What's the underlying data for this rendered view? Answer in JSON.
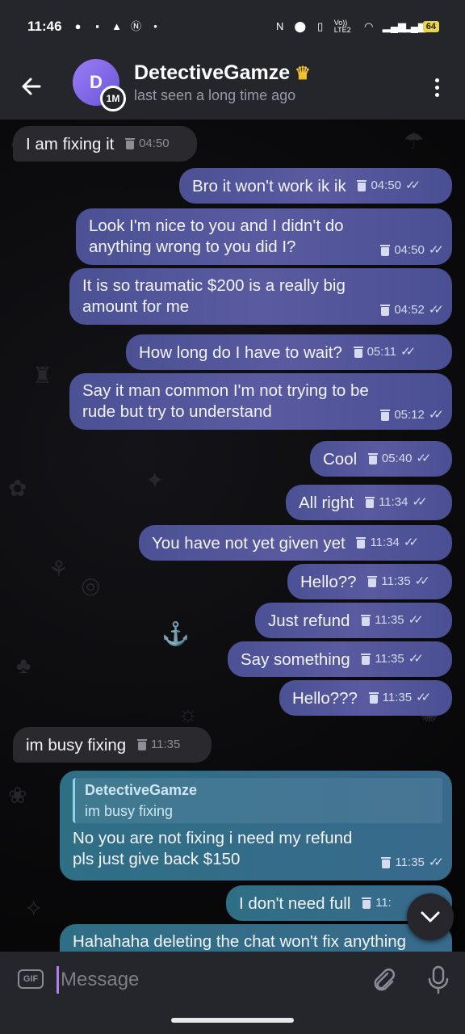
{
  "status_bar": {
    "time": "11:46",
    "battery": "64",
    "signal_label": "Vo)) LTE2"
  },
  "header": {
    "contact_name": "DetectiveGamze",
    "crown_icon": "crown-icon",
    "last_seen": "last seen a long time ago",
    "avatar_letter": "D",
    "story_badge": "1M"
  },
  "messages": [
    {
      "dir": "in",
      "text": "I am fixing it",
      "time": "04:50"
    },
    {
      "dir": "out",
      "text": "Bro it won't work ik ik",
      "time": "04:50"
    },
    {
      "dir": "out",
      "text": "Look I'm nice to you and I didn't do anything wrong to you did I?",
      "time": "04:50"
    },
    {
      "dir": "out",
      "text": "It is so traumatic $200 is a really big amount for me",
      "time": "04:52"
    },
    {
      "dir": "out",
      "text": "How long do I have to wait?",
      "time": "05:11"
    },
    {
      "dir": "out",
      "text": "Say it man common I'm not trying to be rude but try to understand",
      "time": "05:12"
    },
    {
      "dir": "out",
      "text": "Cool",
      "time": "05:40"
    },
    {
      "dir": "out",
      "text": "All right",
      "time": "11:34"
    },
    {
      "dir": "out",
      "text": "You have not yet given yet",
      "time": "11:34"
    },
    {
      "dir": "out",
      "text": "Hello??",
      "time": "11:35"
    },
    {
      "dir": "out",
      "text": "Just refund",
      "time": "11:35"
    },
    {
      "dir": "out",
      "text": "Say something",
      "time": "11:35"
    },
    {
      "dir": "out",
      "text": "Hello???",
      "time": "11:35"
    },
    {
      "dir": "in",
      "text": "im busy fixing",
      "time": "11:35"
    },
    {
      "dir": "out",
      "reply_name": "DetectiveGamze",
      "reply_text": "im busy fixing",
      "text": "No you are not fixing i need my refund pls just give back $150",
      "time": "11:35"
    },
    {
      "dir": "out",
      "text": "I don't need full",
      "time": "11:"
    },
    {
      "dir": "out",
      "text": "Hahahaha deleting the chat won't fix anything",
      "time": ""
    }
  ],
  "input": {
    "gif_label": "GIF",
    "placeholder": "Message"
  },
  "colors": {
    "header_bg": "#25252c",
    "outgoing_bubble": "#5158a0",
    "incoming_bubble": "#2a2a2e",
    "accent": "#b07ff0"
  }
}
